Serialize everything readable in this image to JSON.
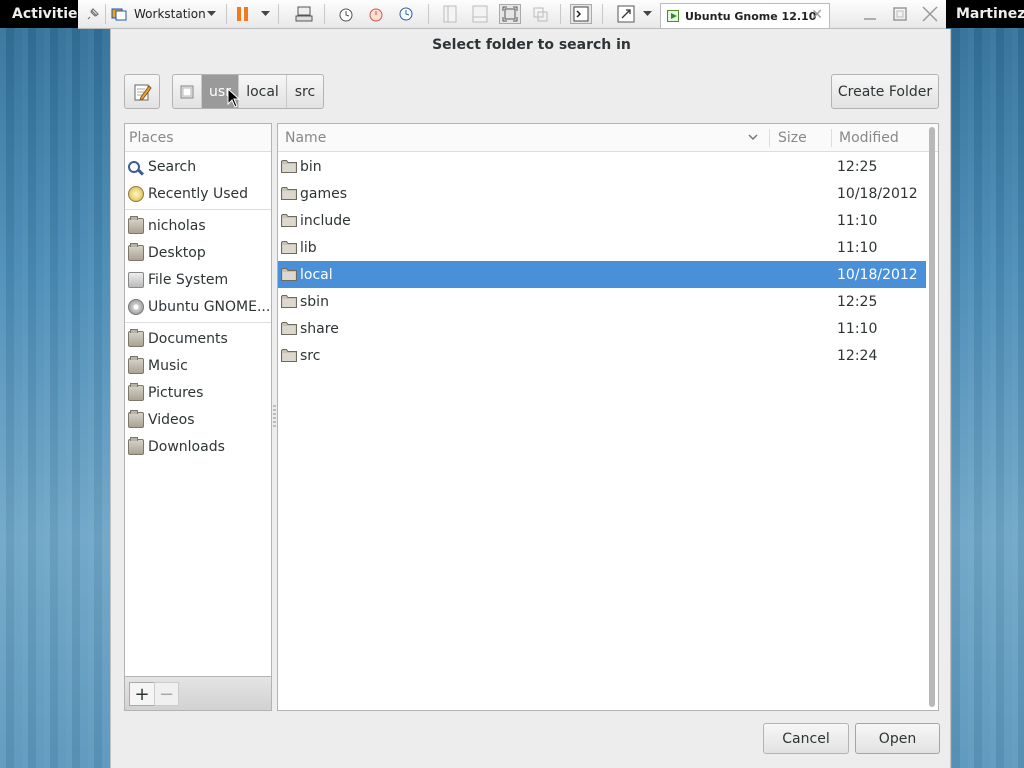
{
  "topbar": {
    "activities": "Activities",
    "user": "Martinez"
  },
  "vm_toolbar": {
    "vm_name": "Workstation",
    "tab_title": "Ubuntu Gnome 12.10",
    "icons": [
      "pin-icon",
      "vm-library-icon",
      "pause-icon",
      "send-ctrl-alt-del-icon",
      "snapshot-icon",
      "revert-snapshot-icon",
      "snapshot-manager-icon",
      "console-view-icon",
      "full-screen-icon",
      "unity-icon",
      "terminal-icon",
      "stretch-icon"
    ]
  },
  "dialog": {
    "title": "Select folder to search in",
    "create_folder": "Create Folder",
    "cancel": "Cancel",
    "open": "Open",
    "path": [
      {
        "label": "",
        "icon": "filesystem-icon"
      },
      {
        "label": "usr",
        "active": true
      },
      {
        "label": "local"
      },
      {
        "label": "src"
      }
    ]
  },
  "places": {
    "header": "Places",
    "groups": [
      [
        {
          "label": "Search",
          "icon": "search-icon"
        },
        {
          "label": "Recently Used",
          "icon": "recent-icon"
        }
      ],
      [
        {
          "label": "nicholas",
          "icon": "home-folder-icon"
        },
        {
          "label": "Desktop",
          "icon": "folder-icon"
        },
        {
          "label": "File System",
          "icon": "drive-icon"
        },
        {
          "label": "Ubuntu GNOME...",
          "icon": "disc-icon"
        }
      ],
      [
        {
          "label": "Documents",
          "icon": "folder-icon"
        },
        {
          "label": "Music",
          "icon": "folder-icon"
        },
        {
          "label": "Pictures",
          "icon": "folder-icon"
        },
        {
          "label": "Videos",
          "icon": "folder-icon"
        },
        {
          "label": "Downloads",
          "icon": "folder-icon"
        }
      ]
    ],
    "add": "+",
    "remove": "−"
  },
  "files": {
    "columns": {
      "name": "Name",
      "size": "Size",
      "modified": "Modified"
    },
    "rows": [
      {
        "name": "bin",
        "modified": "12:25"
      },
      {
        "name": "games",
        "modified": "10/18/2012"
      },
      {
        "name": "include",
        "modified": "11:10"
      },
      {
        "name": "lib",
        "modified": "11:10"
      },
      {
        "name": "local",
        "modified": "10/18/2012",
        "selected": true
      },
      {
        "name": "sbin",
        "modified": "12:25"
      },
      {
        "name": "share",
        "modified": "11:10"
      },
      {
        "name": "src",
        "modified": "12:24"
      }
    ]
  },
  "colors": {
    "selection": "#4a90d9",
    "dialog_bg": "#ededed",
    "topbar": "#000000"
  }
}
